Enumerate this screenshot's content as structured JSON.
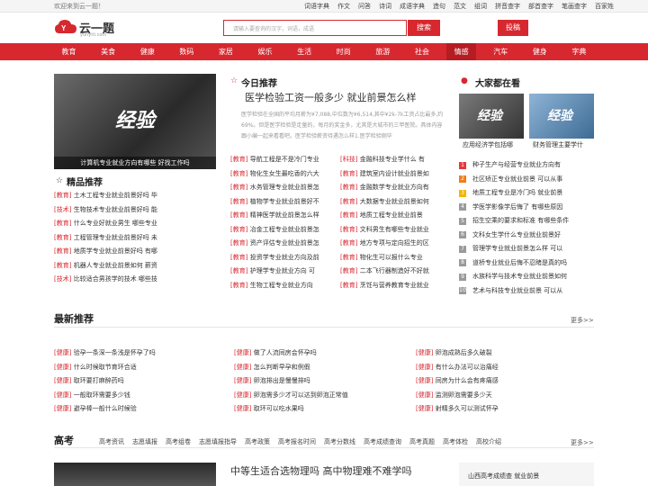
{
  "topbar": {
    "welcome": "欢迎来到云一题！",
    "links": [
      "词语字典",
      "作文",
      "问答",
      "诗词",
      "成语字典",
      "造句",
      "范文",
      "组词",
      "拼音查字",
      "部首查字",
      "笔画查字",
      "百家姓"
    ]
  },
  "header": {
    "logo_text": "云一题",
    "logo_sub": "yunyiti.com",
    "search_placeholder": "请输入要查询的汉字，词语，成语",
    "search_button": "搜索",
    "submit_button": "投稿"
  },
  "nav": {
    "items": [
      "教育",
      "美食",
      "健康",
      "数码",
      "家居",
      "娱乐",
      "生活",
      "时尚",
      "旅游",
      "社会",
      "情感",
      "汽车",
      "健身",
      "字典"
    ],
    "active": "情感"
  },
  "hero": {
    "overlay": "经验",
    "caption": "计算机专业就业方向有哪些 好找工作吗"
  },
  "fine": {
    "title": "精品推荐",
    "items": [
      {
        "tag": "[教育]",
        "text": "土木工程专业就业前景好吗 毕"
      },
      {
        "tag": "[技术]",
        "text": "生物技术专业就业前景好吗 能"
      },
      {
        "tag": "[教育]",
        "text": "什么专业好就业男生 哪些专业"
      },
      {
        "tag": "[教育]",
        "text": "工程管理专业就业前景好吗 未"
      },
      {
        "tag": "[教育]",
        "text": "地质学专业就业前景好吗 有哪"
      },
      {
        "tag": "[教育]",
        "text": "机器人专业就业前景如何 薪资"
      },
      {
        "tag": "[技术]",
        "text": "比较适合男孩学的技术 哪些技"
      }
    ]
  },
  "today": {
    "title": "今日推荐",
    "headline": "医学检验工资一般多少 就业前景怎么样",
    "desc": "医学检验在全国的平均月薪为¥7,088,中位数为¥6,514,其中¥2k-7k工资占比最多,约69%。但是医学检验是走量的，每月的奖金多，尤其是大城市的三甲医院。具体内容跟小编一起来看看吧。医学检验薪资待遇怎么样1.医学检验刚毕",
    "left": [
      {
        "tag": "[教育]",
        "text": "导航工程是不是冷门专业"
      },
      {
        "tag": "[教育]",
        "text": "物化生女生最吃香的六大"
      },
      {
        "tag": "[教育]",
        "text": "水务管理专业就业前景怎"
      },
      {
        "tag": "[教育]",
        "text": "植物学专业就业前景好不"
      },
      {
        "tag": "[教育]",
        "text": "精神医学就业前景怎么样"
      },
      {
        "tag": "[教育]",
        "text": "冶金工程专业就业前景怎"
      },
      {
        "tag": "[教育]",
        "text": "资产评估专业就业前景怎"
      },
      {
        "tag": "[教育]",
        "text": "投资学专业就业方向及前"
      },
      {
        "tag": "[教育]",
        "text": "护理学专业就业方向 可"
      },
      {
        "tag": "[教育]",
        "text": "生物工程专业就业方向"
      }
    ],
    "right": [
      {
        "tag": "[科技]",
        "text": "金融科技专业学什么 有"
      },
      {
        "tag": "[教育]",
        "text": "建筑室内设计就业前景如"
      },
      {
        "tag": "[教育]",
        "text": "金融数学专业就业方向有"
      },
      {
        "tag": "[教育]",
        "text": "大数据专业就业前景如何"
      },
      {
        "tag": "[教育]",
        "text": "地质工程专业就业前景"
      },
      {
        "tag": "[教育]",
        "text": "文科男生有哪些专业就业"
      },
      {
        "tag": "[教育]",
        "text": "地方专项与定向招生的区"
      },
      {
        "tag": "[教育]",
        "text": "物化生可以报什么专业"
      },
      {
        "tag": "[教育]",
        "text": "二本飞行器制造好不好就"
      },
      {
        "tag": "[教育]",
        "text": "烹饪与营养教育专业就业"
      }
    ]
  },
  "everyone": {
    "title": "大家都在看",
    "thumbs": [
      {
        "overlay": "经验",
        "caption": "应用经济学包括哪"
      },
      {
        "overlay": "经验",
        "caption": "财务管理主要学什"
      }
    ],
    "rank": [
      {
        "num": "1",
        "text": "种子生产与经营专业就业方向有"
      },
      {
        "num": "2",
        "text": "社区矫正专业就业前景 可以从事"
      },
      {
        "num": "3",
        "text": "地质工程专业是冷门吗 就业前景"
      },
      {
        "num": "4",
        "text": "学医学影像学后悔了 有哪些原因"
      },
      {
        "num": "5",
        "text": "招生空乘的要求和标准 有哪些条件"
      },
      {
        "num": "6",
        "text": "文科女生学什么专业就业前景好"
      },
      {
        "num": "7",
        "text": "管理学专业就业前景怎么样 可以"
      },
      {
        "num": "8",
        "text": "道桥专业就业后悔不忍睹是真的吗"
      },
      {
        "num": "9",
        "text": "水族科学与技术专业就业前景如何"
      },
      {
        "num": "10",
        "text": "艺术与科技专业就业前景 可以从"
      }
    ],
    "rank_colors": [
      "#e4393c",
      "#f07d1a",
      "#f5b400",
      "#9a9a9a"
    ]
  },
  "latest": {
    "title": "最新推荐",
    "more": "更多>>",
    "col1": [
      {
        "tag": "[健康]",
        "text": "验孕一条深一条浅是怀孕了吗"
      },
      {
        "tag": "[健康]",
        "text": "什么时候取节育环合适"
      },
      {
        "tag": "[健康]",
        "text": "取环要打麻醉药吗"
      },
      {
        "tag": "[健康]",
        "text": "一般取环需要多少钱"
      },
      {
        "tag": "[健康]",
        "text": "避孕棒一般什么时候验"
      }
    ],
    "col2": [
      {
        "tag": "[健康]",
        "text": "做了人流同房会怀孕吗"
      },
      {
        "tag": "[健康]",
        "text": "怎么判断早孕和例假"
      },
      {
        "tag": "[健康]",
        "text": "卵泡排出是慢慢排吗"
      },
      {
        "tag": "[健康]",
        "text": "卵泡需多少才可以达到卵泡正常值"
      },
      {
        "tag": "[健康]",
        "text": "取环可以吃水果吗"
      }
    ],
    "col3": [
      {
        "tag": "[健康]",
        "text": "卵泡成熟后多久破裂"
      },
      {
        "tag": "[健康]",
        "text": "有什么办法可以治痛经"
      },
      {
        "tag": "[健康]",
        "text": "同房为什么会有疼痛感"
      },
      {
        "tag": "[健康]",
        "text": "监测卵泡需要多少天"
      },
      {
        "tag": "[健康]",
        "text": "射精多久可以测试怀孕"
      }
    ]
  },
  "gaokao": {
    "title": "高考",
    "tabs": [
      "高考资讯",
      "志愿填报",
      "高考组卷",
      "志愿填报指导",
      "高考政策",
      "高考报名时间",
      "高考分数线",
      "高考成绩查询",
      "高考真题",
      "高考体检",
      "高校介绍"
    ],
    "more": "更多>>",
    "headline": "中等生适合选物理吗 高中物理难不难学吗",
    "side": "山西高考成绩查    就业前景"
  }
}
